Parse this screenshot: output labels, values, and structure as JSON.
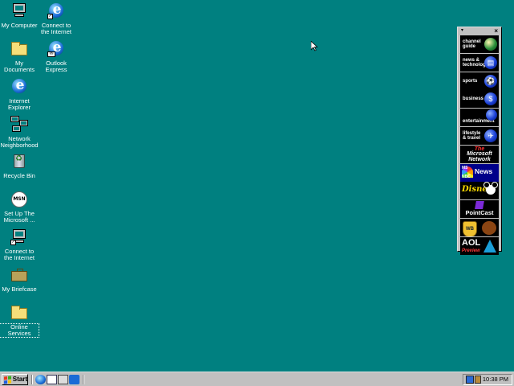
{
  "desktop": {
    "background_color": "#008080",
    "icons": [
      {
        "label": "My Computer",
        "icon": "my-computer-icon"
      },
      {
        "label": "Connect to the Internet",
        "icon": "connect-internet-icon"
      },
      {
        "label": "My Documents",
        "icon": "folder-icon"
      },
      {
        "label": "Outlook Express",
        "icon": "outlook-express-icon"
      },
      {
        "label": "Internet Explorer",
        "icon": "internet-explorer-icon"
      },
      {
        "label": "Network Neighborhood",
        "icon": "network-neighborhood-icon"
      },
      {
        "label": "Recycle Bin",
        "icon": "recycle-bin-icon"
      },
      {
        "label": "Set Up The Microsoft ...",
        "icon": "msn-icon"
      },
      {
        "label": "Connect to the Internet",
        "icon": "connect-internet-icon"
      },
      {
        "label": "My Briefcase",
        "icon": "briefcase-icon"
      },
      {
        "label": "Online Services",
        "icon": "folder-icon"
      }
    ]
  },
  "channel_bar": {
    "channels": [
      {
        "label": "channel\nguide",
        "icon": "channel-guide-icon"
      },
      {
        "label": "news &\ntechnology",
        "icon": "news-icon"
      },
      {
        "label": "sports",
        "icon": "sports-icon"
      },
      {
        "label": "business",
        "icon": "business-icon"
      },
      {
        "label": "entertainment",
        "icon": "entertainment-icon"
      },
      {
        "label": "lifestyle\n& travel",
        "icon": "travel-icon"
      },
      {
        "label_top": "The",
        "label_main": "Microsoft\nNetwork",
        "icon": "msn-logo"
      },
      {
        "label_a": "MS",
        "label_b": "NBC",
        "label_c": "News",
        "icon": "msnbc-logo"
      },
      {
        "label": "Disney",
        "icon": "disney-logo"
      },
      {
        "label": "PointCast",
        "icon": "pointcast-logo"
      },
      {
        "label": "WB",
        "icon": "warner-bros-logo"
      },
      {
        "label": "AOL",
        "sublabel": "Preview",
        "icon": "aol-logo"
      }
    ],
    "menu_glyph": "▾",
    "close_glyph": "×"
  },
  "taskbar": {
    "start_label": "Start",
    "quick_launch": [
      {
        "icon": "internet-explorer-icon"
      },
      {
        "icon": "outlook-express-icon"
      },
      {
        "icon": "show-desktop-icon"
      },
      {
        "icon": "view-channels-icon"
      }
    ],
    "clock": "10:38 PM"
  }
}
